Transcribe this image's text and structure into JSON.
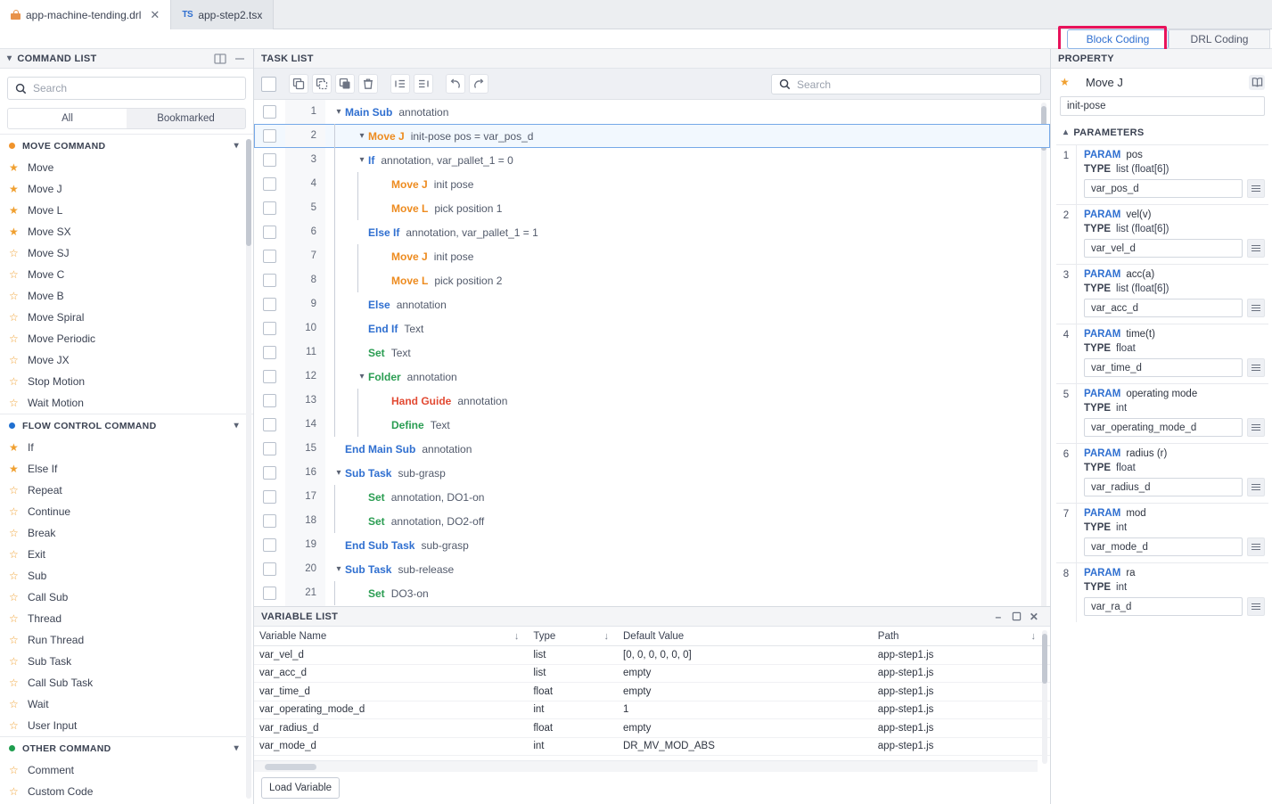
{
  "window": {
    "file_tabs": [
      {
        "label": "app-machine-tending.drl",
        "icon": "lock-icon",
        "active": true,
        "closable": true
      },
      {
        "label": "app-step2.tsx",
        "icon": "typescript-icon",
        "active": false,
        "closable": false
      }
    ],
    "mode_tabs": [
      {
        "label": "Block Coding",
        "active": true
      },
      {
        "label": "DRL Coding",
        "active": false
      }
    ],
    "highlight_color": "#e8125b"
  },
  "sidebar": {
    "title": "COMMAND LIST",
    "search": {
      "placeholder": "Search",
      "value": ""
    },
    "filters": [
      {
        "label": "All",
        "active": true
      },
      {
        "label": "Bookmarked",
        "active": false
      }
    ],
    "groups": [
      {
        "title": "MOVE COMMAND",
        "dot_color": "#f0932b",
        "items": [
          {
            "label": "Move",
            "bookmarked": true
          },
          {
            "label": "Move J",
            "bookmarked": true
          },
          {
            "label": "Move L",
            "bookmarked": true
          },
          {
            "label": "Move SX",
            "bookmarked": true
          },
          {
            "label": "Move SJ",
            "bookmarked": false
          },
          {
            "label": "Move C",
            "bookmarked": false
          },
          {
            "label": "Move B",
            "bookmarked": false
          },
          {
            "label": "Move Spiral",
            "bookmarked": false
          },
          {
            "label": "Move Periodic",
            "bookmarked": false
          },
          {
            "label": "Move JX",
            "bookmarked": false
          },
          {
            "label": "Stop Motion",
            "bookmarked": false
          },
          {
            "label": "Wait Motion",
            "bookmarked": false
          }
        ]
      },
      {
        "title": "FLOW CONTROL COMMAND",
        "dot_color": "#1f6fd0",
        "items": [
          {
            "label": "If",
            "bookmarked": true
          },
          {
            "label": "Else If",
            "bookmarked": true
          },
          {
            "label": "Repeat",
            "bookmarked": false
          },
          {
            "label": "Continue",
            "bookmarked": false
          },
          {
            "label": "Break",
            "bookmarked": false
          },
          {
            "label": "Exit",
            "bookmarked": false
          },
          {
            "label": "Sub",
            "bookmarked": false
          },
          {
            "label": "Call Sub",
            "bookmarked": false
          },
          {
            "label": "Thread",
            "bookmarked": false
          },
          {
            "label": "Run Thread",
            "bookmarked": false
          },
          {
            "label": "Sub Task",
            "bookmarked": false
          },
          {
            "label": "Call Sub Task",
            "bookmarked": false
          },
          {
            "label": "Wait",
            "bookmarked": false
          },
          {
            "label": "User Input",
            "bookmarked": false
          }
        ]
      },
      {
        "title": "OTHER COMMAND",
        "dot_color": "#1f9d4e",
        "items": [
          {
            "label": "Comment",
            "bookmarked": false
          },
          {
            "label": "Custom Code",
            "bookmarked": false
          }
        ]
      }
    ]
  },
  "tasklist": {
    "title": "TASK LIST",
    "search": {
      "placeholder": "Search",
      "value": ""
    },
    "toolbar": [
      {
        "name": "copy-button",
        "label": "Copy"
      },
      {
        "name": "duplicate-button",
        "label": "Duplicate"
      },
      {
        "name": "paste-button",
        "label": "Paste"
      },
      {
        "name": "delete-button",
        "label": "Delete"
      },
      {
        "name": "outdent-button",
        "label": "Outdent"
      },
      {
        "name": "indent-button",
        "label": "Indent"
      },
      {
        "name": "undo-button",
        "label": "Undo"
      },
      {
        "name": "redo-button",
        "label": "Redo"
      }
    ],
    "rows": [
      {
        "num": "1",
        "indent": 0,
        "twist": "down",
        "kw": "Main Sub",
        "kwcolor": "blue",
        "ann": "annotation",
        "selected": false
      },
      {
        "num": "2",
        "indent": 1,
        "twist": "down",
        "kw": "Move J",
        "kwcolor": "orange",
        "ann": "init-pose   pos = var_pos_d",
        "selected": true
      },
      {
        "num": "3",
        "indent": 1,
        "twist": "down",
        "kw": "If",
        "kwcolor": "blue",
        "ann": "annotation,   var_pallet_1 = 0",
        "selected": false
      },
      {
        "num": "4",
        "indent": 2,
        "twist": "",
        "kw": "Move J",
        "kwcolor": "orange",
        "ann": "init pose",
        "selected": false
      },
      {
        "num": "5",
        "indent": 2,
        "twist": "",
        "kw": "Move L",
        "kwcolor": "orange",
        "ann": "pick position 1",
        "selected": false
      },
      {
        "num": "6",
        "indent": 1,
        "twist": "",
        "kw": "Else If",
        "kwcolor": "blue",
        "ann": "annotation,   var_pallet_1 = 1",
        "selected": false
      },
      {
        "num": "7",
        "indent": 2,
        "twist": "",
        "kw": "Move J",
        "kwcolor": "orange",
        "ann": "init pose",
        "selected": false
      },
      {
        "num": "8",
        "indent": 2,
        "twist": "",
        "kw": "Move L",
        "kwcolor": "orange",
        "ann": "pick position 2",
        "selected": false
      },
      {
        "num": "9",
        "indent": 1,
        "twist": "",
        "kw": "Else",
        "kwcolor": "blue",
        "ann": "annotation",
        "selected": false
      },
      {
        "num": "10",
        "indent": 1,
        "twist": "",
        "kw": "End If",
        "kwcolor": "blue",
        "ann": "Text",
        "selected": false
      },
      {
        "num": "11",
        "indent": 1,
        "twist": "",
        "kw": "Set",
        "kwcolor": "green",
        "ann": "Text",
        "selected": false
      },
      {
        "num": "12",
        "indent": 1,
        "twist": "down",
        "kw": "Folder",
        "kwcolor": "green",
        "ann": "annotation",
        "selected": false
      },
      {
        "num": "13",
        "indent": 2,
        "twist": "",
        "kw": "Hand Guide",
        "kwcolor": "red",
        "ann": "annotation",
        "selected": false
      },
      {
        "num": "14",
        "indent": 2,
        "twist": "",
        "kw": "Define",
        "kwcolor": "green",
        "ann": "Text",
        "selected": false
      },
      {
        "num": "15",
        "indent": 0,
        "twist": "",
        "kw": "End Main Sub",
        "kwcolor": "blue",
        "ann": "annotation",
        "selected": false
      },
      {
        "num": "16",
        "indent": 0,
        "twist": "down",
        "kw": "Sub Task",
        "kwcolor": "blue",
        "ann": "sub-grasp",
        "selected": false
      },
      {
        "num": "17",
        "indent": 1,
        "twist": "",
        "kw": "Set",
        "kwcolor": "green",
        "ann": "annotation,   DO1-on",
        "selected": false
      },
      {
        "num": "18",
        "indent": 1,
        "twist": "",
        "kw": "Set",
        "kwcolor": "green",
        "ann": "annotation,   DO2-off",
        "selected": false
      },
      {
        "num": "19",
        "indent": 0,
        "twist": "",
        "kw": "End Sub Task",
        "kwcolor": "blue",
        "ann": "sub-grasp",
        "selected": false
      },
      {
        "num": "20",
        "indent": 0,
        "twist": "down",
        "kw": "Sub Task",
        "kwcolor": "blue",
        "ann": "sub-release",
        "selected": false
      },
      {
        "num": "21",
        "indent": 1,
        "twist": "",
        "kw": "Set",
        "kwcolor": "green",
        "ann": "DO3-on",
        "selected": false
      }
    ]
  },
  "variablelist": {
    "title": "VARIABLE LIST",
    "columns": [
      "Variable Name",
      "Type",
      "Default Value",
      "Path"
    ],
    "rows": [
      {
        "name": "var_vel_d",
        "type": "list",
        "default": "[0, 0, 0, 0, 0, 0]",
        "path": "app-step1.js"
      },
      {
        "name": "var_acc_d",
        "type": "list",
        "default": "empty",
        "path": "app-step1.js"
      },
      {
        "name": "var_time_d",
        "type": "float",
        "default": "empty",
        "path": "app-step1.js"
      },
      {
        "name": "var_operating_mode_d",
        "type": "int",
        "default": "1",
        "path": "app-step1.js"
      },
      {
        "name": "var_radius_d",
        "type": "float",
        "default": "empty",
        "path": "app-step1.js"
      },
      {
        "name": "var_mode_d",
        "type": "int",
        "default": "DR_MV_MOD_ABS",
        "path": "app-step1.js"
      }
    ],
    "load_button": "Load Variable"
  },
  "property": {
    "title": "PROPERTY",
    "command": "Move J",
    "bookmarked": true,
    "name_value": "init-pose",
    "parameters_title": "PARAMETERS",
    "param_label": "PARAM",
    "type_label": "TYPE",
    "parameters": [
      {
        "idx": "1",
        "param": "pos",
        "type": "list (float[6])",
        "value": "var_pos_d"
      },
      {
        "idx": "2",
        "param": "vel(v)",
        "type": "list (float[6])",
        "value": "var_vel_d"
      },
      {
        "idx": "3",
        "param": "acc(a)",
        "type": "list (float[6])",
        "value": "var_acc_d"
      },
      {
        "idx": "4",
        "param": "time(t)",
        "type": "float",
        "value": "var_time_d"
      },
      {
        "idx": "5",
        "param": "operating mode",
        "type": "int",
        "value": "var_operating_mode_d"
      },
      {
        "idx": "6",
        "param": "radius (r)",
        "type": "float",
        "value": "var_radius_d"
      },
      {
        "idx": "7",
        "param": "mod",
        "type": "int",
        "value": "var_mode_d"
      },
      {
        "idx": "8",
        "param": "ra",
        "type": "int",
        "value": "var_ra_d"
      }
    ]
  }
}
